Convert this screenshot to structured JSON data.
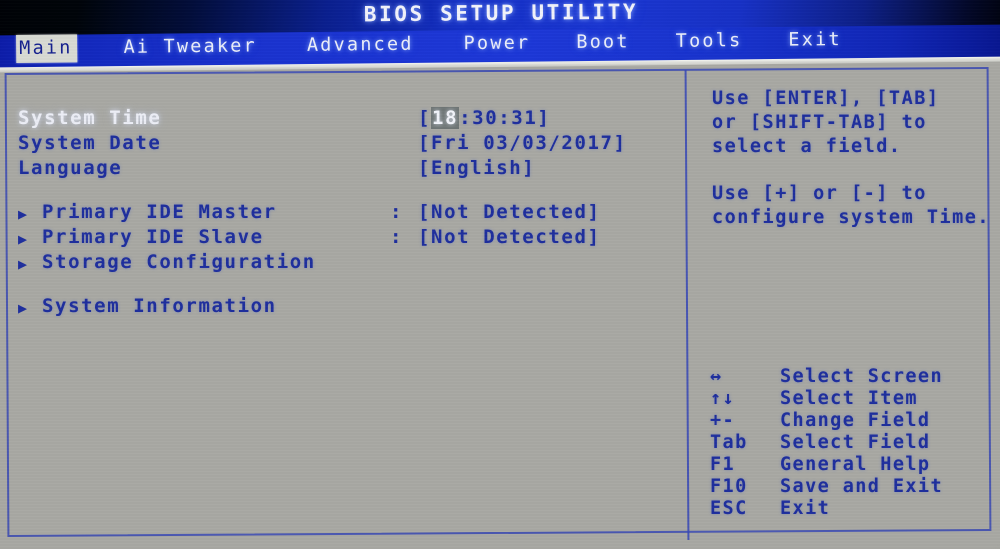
{
  "window": {
    "title": "BIOS SETUP UTILITY"
  },
  "menu": {
    "items": [
      {
        "label": "Main",
        "active": true
      },
      {
        "label": "Ai Tweaker",
        "active": false
      },
      {
        "label": "Advanced",
        "active": false
      },
      {
        "label": "Power",
        "active": false
      },
      {
        "label": "Boot",
        "active": false
      },
      {
        "label": "Tools",
        "active": false
      },
      {
        "label": "Exit",
        "active": false
      }
    ]
  },
  "main": {
    "fields": [
      {
        "label": "System Time",
        "selected": true,
        "value_prefix": "[",
        "value_highlight": "18",
        "value_suffix": ":30:31]"
      },
      {
        "label": "System Date",
        "selected": false,
        "value": "[Fri 03/03/2017]"
      },
      {
        "label": "Language",
        "selected": false,
        "value": "[English]"
      }
    ],
    "submenus": [
      {
        "arrow": "▶",
        "label": "Primary IDE Master",
        "colon": ":",
        "value": "[Not Detected]"
      },
      {
        "arrow": "▶",
        "label": "Primary IDE Slave",
        "colon": ":",
        "value": "[Not Detected]"
      },
      {
        "arrow": "▶",
        "label": "Storage Configuration",
        "colon": "",
        "value": ""
      },
      {
        "arrow": "▶",
        "label": "System Information",
        "colon": "",
        "value": ""
      }
    ]
  },
  "help": {
    "lines": [
      "Use [ENTER], [TAB]",
      "or [SHIFT-TAB] to",
      "select a field.",
      "",
      "Use [+] or [-] to",
      "configure system Time."
    ]
  },
  "legend": {
    "entries": [
      {
        "key": "↔",
        "desc": "Select Screen"
      },
      {
        "key": "↑↓",
        "desc": "Select Item"
      },
      {
        "key": "+-",
        "desc": "Change Field"
      },
      {
        "key": "Tab",
        "desc": "Select Field"
      },
      {
        "key": "F1",
        "desc": "General Help"
      },
      {
        "key": "F10",
        "desc": "Save and Exit"
      },
      {
        "key": "ESC",
        "desc": "Exit"
      }
    ]
  },
  "colors": {
    "background": "#a9a9a4",
    "text_blue": "#1f2f9e",
    "menu_blue": "#1d38d8",
    "title_blue": "#1530c4",
    "highlight_bg": "#d9dbd4",
    "selected_text": "#eceef6"
  }
}
